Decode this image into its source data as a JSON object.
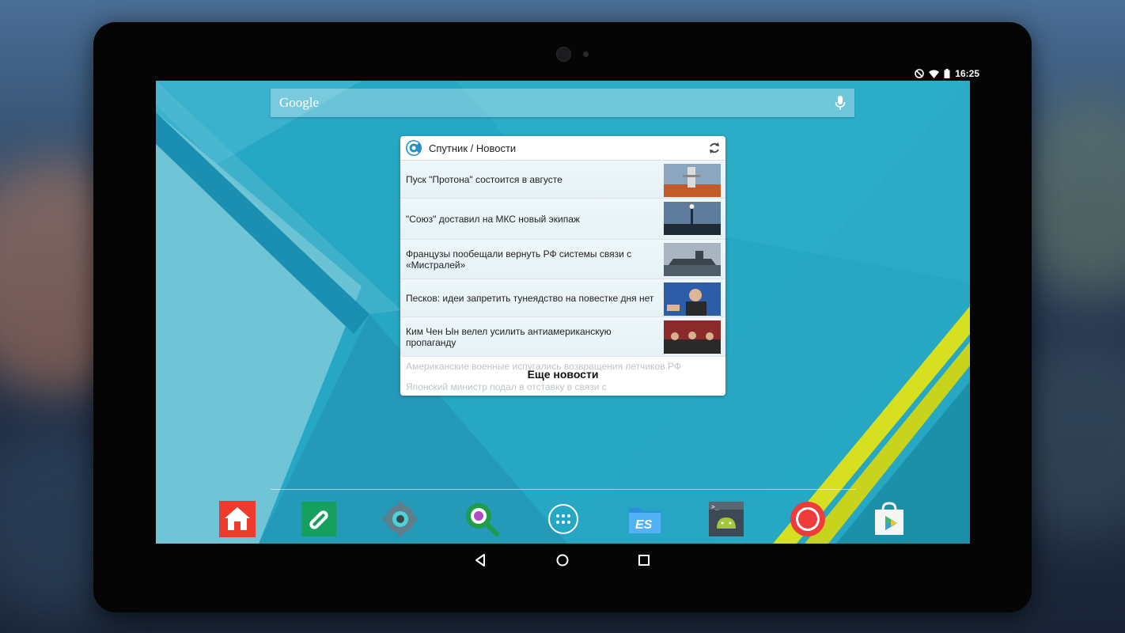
{
  "status_bar": {
    "time": "16:25"
  },
  "search": {
    "logo": "Google",
    "icon": "mic-icon"
  },
  "widget": {
    "title": "Спутник / Новости",
    "refresh_icon": "refresh-icon",
    "items": [
      {
        "text": "Пуск \"Протона\" состоится в августе"
      },
      {
        "text": "\"Союз\" доставил на МКС новый экипаж"
      },
      {
        "text": "Французы пообещали вернуть РФ системы связи с «Мистралей»"
      },
      {
        "text": "Песков: идеи запретить тунеядство на повестке дня нет"
      },
      {
        "text": "Ким Чен Ын велел усилить антиамериканскую пропаганду"
      }
    ],
    "faded_item_1": "Американские военные испугались возвращения летчиков РФ",
    "faded_item_2": "Японский министр подал в отставку в связи с",
    "more_label": "Еще новости"
  },
  "dock": [
    {
      "name": "home-launcher-icon"
    },
    {
      "name": "link-app-icon"
    },
    {
      "name": "settings-gear-icon"
    },
    {
      "name": "gear-search-icon"
    },
    {
      "name": "app-drawer-icon"
    },
    {
      "name": "es-file-explorer-icon"
    },
    {
      "name": "android-terminal-icon"
    },
    {
      "name": "record-button-icon"
    },
    {
      "name": "play-store-icon"
    }
  ],
  "colors": {
    "wallpaper": "#26a7c4",
    "accent_yellow": "#d6e021",
    "widget_bg": "#ffffff"
  }
}
